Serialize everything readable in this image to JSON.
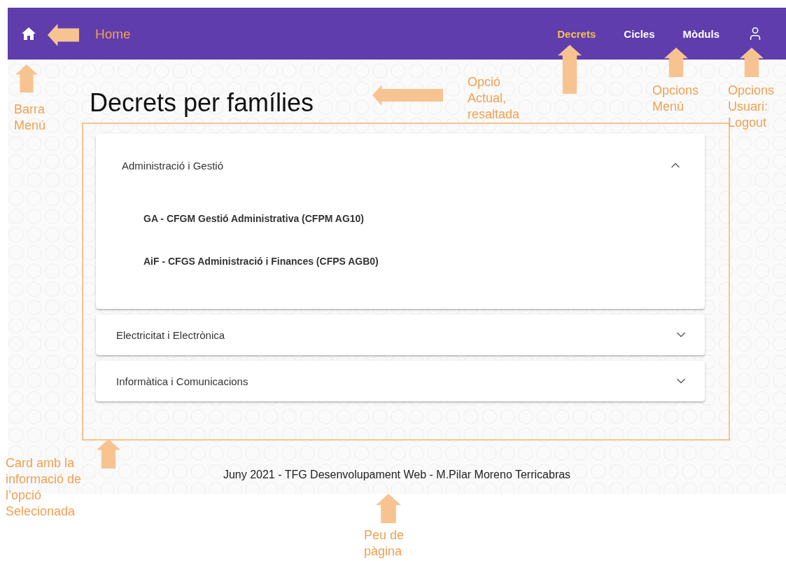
{
  "navbar": {
    "menu": [
      {
        "label": "Decrets",
        "selected": true
      },
      {
        "label": "Cicles",
        "selected": false
      },
      {
        "label": "Mòduls",
        "selected": false
      }
    ]
  },
  "title": "Decrets per famílies",
  "families": [
    {
      "name": "Administració i Gestió",
      "expanded": true,
      "children": [
        {
          "label": "GA - CFGM Gestió Administrativa (CFPM AG10)"
        },
        {
          "label": "AiF - CFGS Administració i Finances (CFPS AGB0)"
        }
      ]
    },
    {
      "name": "Electricitat i Electrònica",
      "expanded": false
    },
    {
      "name": "Informàtica i Comunicacions",
      "expanded": false
    }
  ],
  "footer": "Juny 2021 - TFG Desenvolupament Web - M.Pilar Moreno Terricabras",
  "annotations": [
    {
      "text": "Home"
    },
    {
      "text": "Barra\nMenú"
    },
    {
      "text": "Opció\nActual,\nresaltada"
    },
    {
      "text": "Opcions\nMenú"
    },
    {
      "text": "Opcions\nUsuari:\nLogout"
    },
    {
      "text": "Card amb la\ninformació de\nl’opció\nSelecionada"
    },
    {
      "text": "Peu de\npàgina"
    }
  ]
}
